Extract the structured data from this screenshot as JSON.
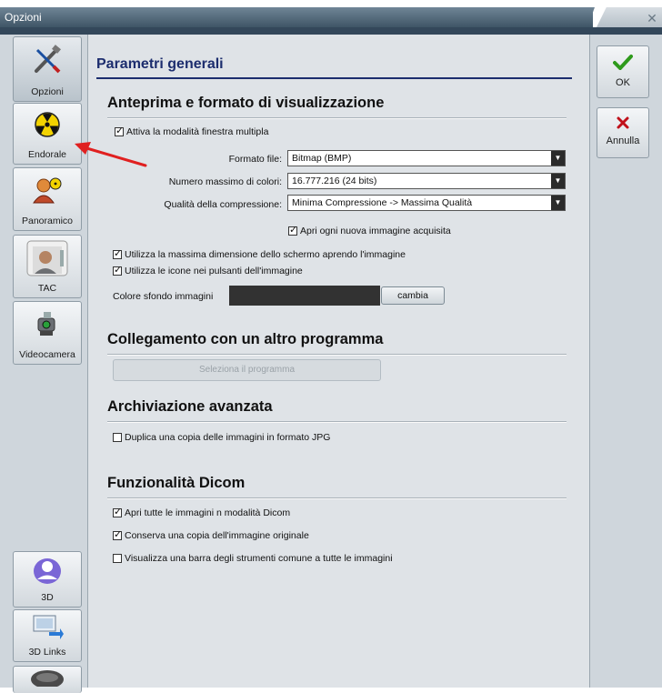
{
  "window": {
    "title": "Opzioni",
    "close_glyph": "✕"
  },
  "sidebar": {
    "items": [
      {
        "label": "Opzioni",
        "icon": "tools-icon"
      },
      {
        "label": "Endorale",
        "icon": "radiation-icon"
      },
      {
        "label": "Panoramico",
        "icon": "user-radiation-icon"
      },
      {
        "label": "TAC",
        "icon": "scanner-icon"
      },
      {
        "label": "Videocamera",
        "icon": "camera-icon"
      },
      {
        "label": "3D",
        "icon": "user-3d-icon"
      },
      {
        "label": "3D Links",
        "icon": "monitor-link-icon"
      }
    ]
  },
  "actions": {
    "ok_label": "OK",
    "cancel_label": "Annulla",
    "ok_color": "#2e9a1c",
    "cancel_color": "#c0101a"
  },
  "main": {
    "title": "Parametri generali",
    "preview": {
      "heading": "Anteprima e formato di visualizzazione",
      "multi_window_label": "Attiva la modalità finestra multipla",
      "file_format_label": "Formato file:",
      "file_format_value": "Bitmap (BMP)",
      "max_colors_label": "Numero massimo di colori:",
      "max_colors_value": "16.777.216 (24 bits)",
      "compression_label": "Qualità della compressione:",
      "compression_value": "Minima Compressione -> Massima Qualità",
      "open_new_label": "Apri ogni nuova immagine acquisita",
      "max_screen_label": "Utilizza la massima dimensione dello schermo aprendo l'immagine",
      "use_icons_label": "Utilizza le icone nei pulsanti dell'immagine",
      "bg_color_label": "Colore sfondo immagini",
      "bg_color_value": "#323232",
      "change_label": "cambia"
    },
    "link": {
      "heading": "Collegamento con un altro programma",
      "select_program_label": "Seleziona il programma"
    },
    "archive": {
      "heading": "Archiviazione avanzata",
      "duplicate_jpg_label": "Duplica una copia delle immagini in formato JPG"
    },
    "dicom": {
      "heading": "Funzionalità Dicom",
      "open_dicom_label": "Apri tutte le immagini n modalità Dicom",
      "keep_copy_label": "Conserva una copia dell'immagine originale",
      "common_toolbar_label": "Visualizza una barra degli strumenti comune a tutte le immagini"
    }
  },
  "annotation": {
    "arrow_color": "#e02020"
  }
}
